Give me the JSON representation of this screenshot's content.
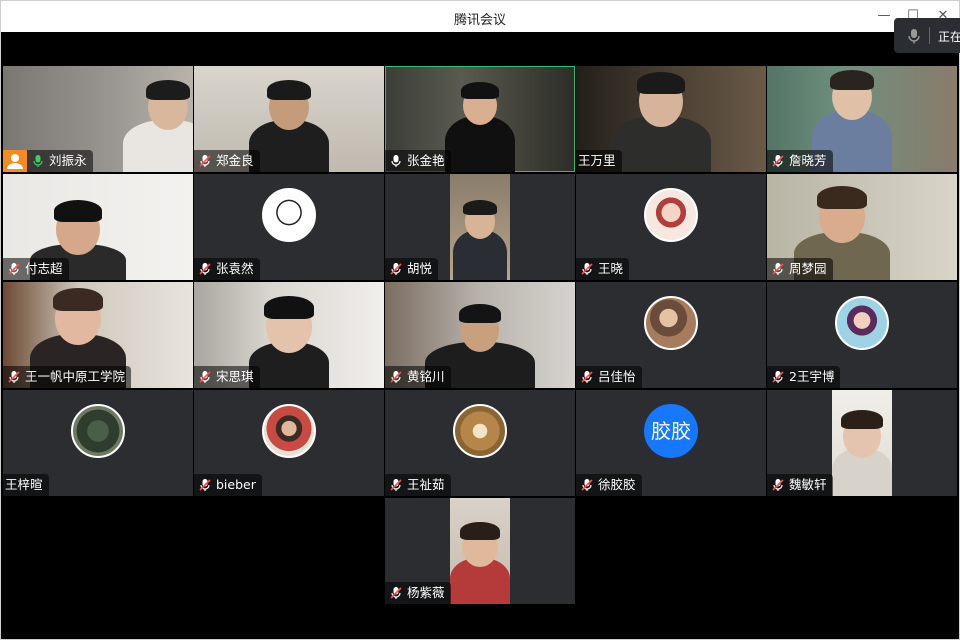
{
  "window": {
    "title": "腾讯会议",
    "speaking_indicator": "正在"
  },
  "participants": [
    {
      "name": "刘振永",
      "mic": "on",
      "host": true,
      "type": "video",
      "active": false
    },
    {
      "name": "郑金良",
      "mic": "muted",
      "host": false,
      "type": "video",
      "active": false
    },
    {
      "name": "张金艳",
      "mic": "on-white",
      "host": false,
      "type": "video",
      "active": true
    },
    {
      "name": "王万里",
      "mic": "none",
      "host": false,
      "type": "video",
      "active": false
    },
    {
      "name": "詹晓芳",
      "mic": "muted",
      "host": false,
      "type": "video",
      "active": false
    },
    {
      "name": "付志超",
      "mic": "muted",
      "host": false,
      "type": "video",
      "active": false
    },
    {
      "name": "张袁然",
      "mic": "muted",
      "host": false,
      "type": "avatar",
      "active": false
    },
    {
      "name": "胡悦",
      "mic": "muted",
      "host": false,
      "type": "video-narrow",
      "active": false
    },
    {
      "name": "王晓",
      "mic": "muted",
      "host": false,
      "type": "avatar",
      "active": false
    },
    {
      "name": "周梦园",
      "mic": "muted",
      "host": false,
      "type": "video",
      "active": false
    },
    {
      "name": "王一帆中原工学院",
      "mic": "muted",
      "host": false,
      "type": "video",
      "active": false
    },
    {
      "name": "宋思琪",
      "mic": "muted",
      "host": false,
      "type": "video",
      "active": false
    },
    {
      "name": "黄铭川",
      "mic": "muted",
      "host": false,
      "type": "video",
      "active": false
    },
    {
      "name": "吕佳怡",
      "mic": "muted",
      "host": false,
      "type": "avatar",
      "active": false
    },
    {
      "name": "2王宇博",
      "mic": "muted",
      "host": false,
      "type": "avatar",
      "active": false
    },
    {
      "name": "王梓暄",
      "mic": "none",
      "host": false,
      "type": "avatar",
      "active": false
    },
    {
      "name": "bieber",
      "mic": "muted",
      "host": false,
      "type": "avatar",
      "active": false
    },
    {
      "name": "王祉茹",
      "mic": "muted",
      "host": false,
      "type": "avatar",
      "active": false
    },
    {
      "name": "徐胶胶",
      "mic": "muted",
      "host": false,
      "type": "avatar-text",
      "avatar_text": "胶胶",
      "active": false
    },
    {
      "name": "魏敏轩",
      "mic": "muted",
      "host": false,
      "type": "video-narrow",
      "active": false
    },
    {
      "name": "杨紫薇",
      "mic": "muted",
      "host": false,
      "type": "video-narrow",
      "active": false
    }
  ],
  "colors": {
    "active_border": "#2fbf71",
    "host_badge": "#f68b1f",
    "mic_on": "#3ccf5a",
    "mic_muted": "#ff4d4f",
    "tile_bg": "#2b2d30",
    "text_avatar_bg": "#1677ff"
  }
}
